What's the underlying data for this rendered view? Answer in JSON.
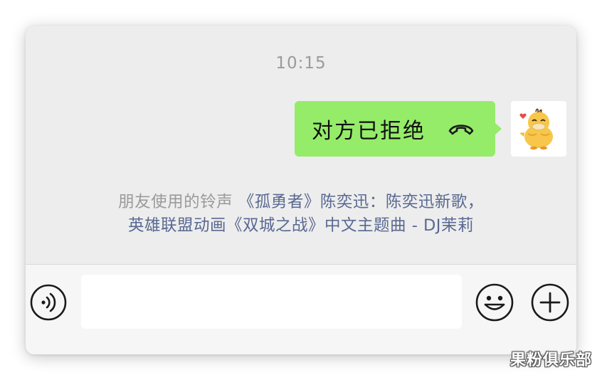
{
  "chat": {
    "timestamp": "10:15",
    "message": {
      "text": "对方已拒绝",
      "icon": "phone-hangup-icon",
      "bubble_color": "#95ec69",
      "sender_avatar": "duck-cartoon-avatar"
    },
    "ringtone": {
      "prefix": "朋友使用的铃声",
      "song_line1": "《孤勇者》陈奕迅：陈奕迅新歌，",
      "song_line2": "英雄联盟动画《双城之战》中文主题曲 - DJ茉莉",
      "link_color": "#586891"
    }
  },
  "input_bar": {
    "left_icon": "voice-icon",
    "text_value": "",
    "right_icons": [
      "emoji-icon",
      "plus-icon"
    ]
  },
  "watermark": {
    "text": "果粉俱乐部"
  }
}
